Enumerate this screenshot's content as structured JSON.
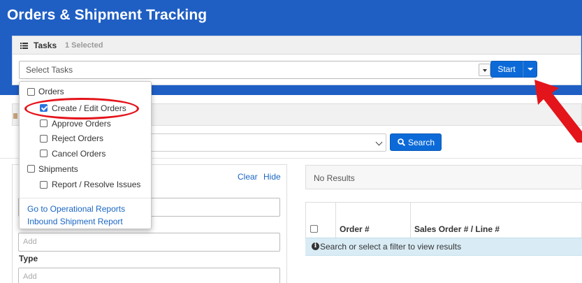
{
  "app": {
    "title": "Orders & Shipment Tracking"
  },
  "tasks": {
    "label": "Tasks",
    "selected_count": "1 Selected",
    "select_placeholder": "Select Tasks",
    "start_label": "Start"
  },
  "dropdown": {
    "items": [
      {
        "label": "Orders",
        "checked": false,
        "indent": 0
      },
      {
        "label": "Create / Edit Orders",
        "checked": true,
        "indent": 1
      },
      {
        "label": "Approve Orders",
        "checked": false,
        "indent": 1
      },
      {
        "label": "Reject Orders",
        "checked": false,
        "indent": 1
      },
      {
        "label": "Cancel Orders",
        "checked": false,
        "indent": 1
      },
      {
        "label": "Shipments",
        "checked": false,
        "indent": 0
      },
      {
        "label": "Report / Resolve Issues",
        "checked": false,
        "indent": 1
      }
    ],
    "links": [
      "Go to Operational Reports",
      "Inbound Shipment Report"
    ]
  },
  "search": {
    "button_label": "Search"
  },
  "filters": {
    "clear_label": "Clear",
    "hide_label": "Hide",
    "add_placeholder": "Add",
    "type_label": "Type"
  },
  "results": {
    "status": "No Results",
    "columns": [
      "Order #",
      "Sales Order # / Line #"
    ],
    "hint": "Search or select a filter to view results"
  },
  "colors": {
    "header_blue": "#1f5fc4",
    "primary_button": "#0c6ad8",
    "link_blue": "#1a66c4",
    "annotation_red": "#e4141b",
    "hint_row": "#d9ecf5"
  }
}
